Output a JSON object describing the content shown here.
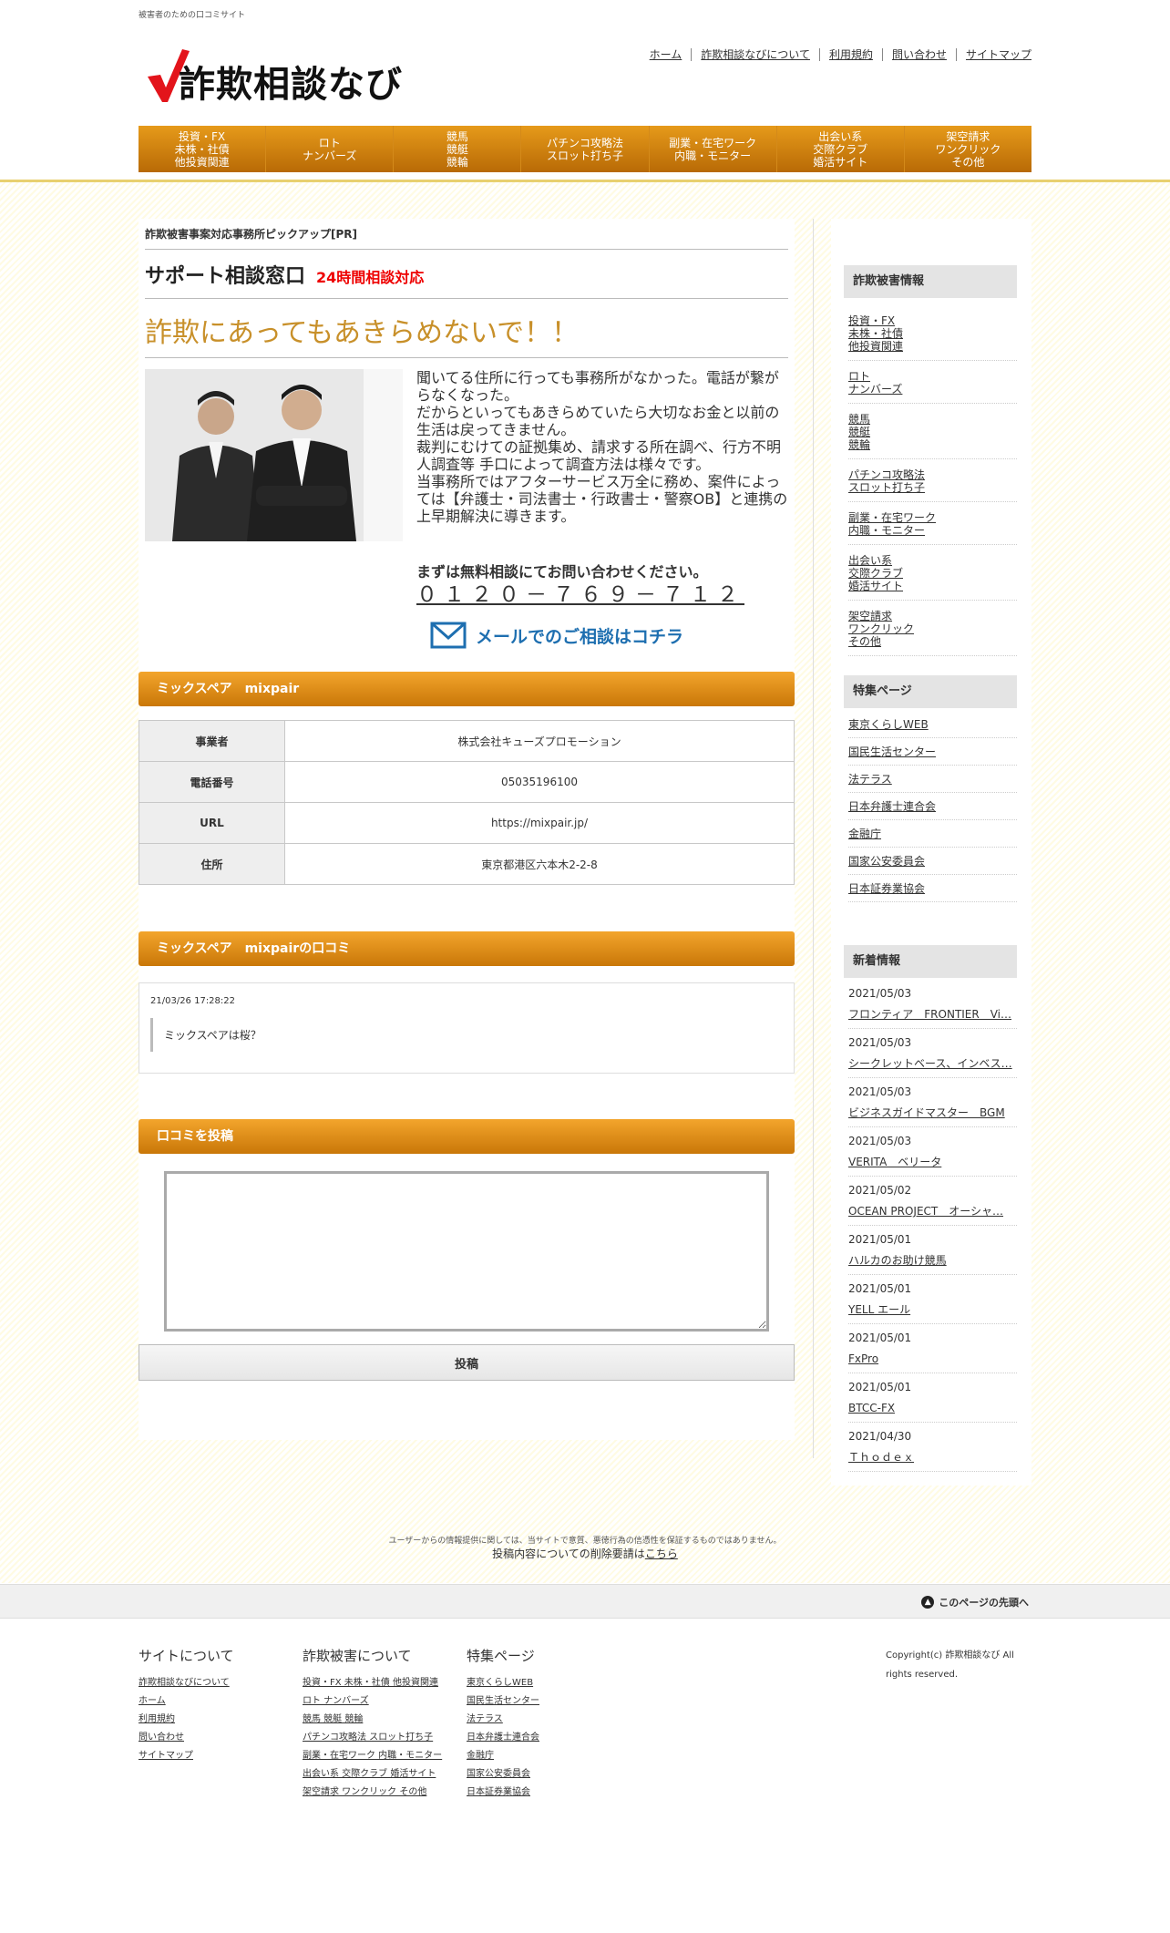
{
  "header": {
    "tagline": "被害者のための口コミサイト",
    "logo_text": "詐欺相談なび",
    "toplinks": [
      "ホーム",
      "詐欺相談なびについて",
      "利用規約",
      "問い合わせ",
      "サイトマップ"
    ]
  },
  "gnav": [
    [
      "投資・FX",
      "未株・社債",
      "他投資関連"
    ],
    [
      "ロト",
      "ナンバーズ"
    ],
    [
      "競馬",
      "競艇",
      "競輪"
    ],
    [
      "パチンコ攻略法",
      "スロット打ち子"
    ],
    [
      "副業・在宅ワーク",
      "内職・モニター"
    ],
    [
      "出会い系",
      "交際クラブ",
      "婚活サイト"
    ],
    [
      "架空請求",
      "ワンクリック",
      "その他"
    ]
  ],
  "pr": {
    "title": "詐欺被害事案対応事務所ピックアップ[PR]",
    "support": "サポート相談窓口",
    "support_note": "24時間相談対応",
    "catch": "詐欺にあってもあきらめないで！！",
    "desc": [
      "聞いてる住所に行っても事務所がなかった。電話が繋がらなくなった。",
      "だからといってもあきらめていたら大切なお金と以前の生活は戻ってきません。",
      "裁判にむけての証拠集め、請求する所在調べ、行方不明人調査等 手口によって調査方法は様々です。",
      "当事務所ではアフターサービス万全に務め、案件によっては【弁護士・司法書士・行政書士・警察OB】と連携の上早期解決に導きます。"
    ],
    "free": "まずは無料相談にてお問い合わせください。",
    "tel": "０１２０－７６９－７１２",
    "mail": "メールでのご相談はコチラ"
  },
  "company": {
    "heading": "ミックスペア　mixpair",
    "rows": [
      {
        "k": "事業者",
        "v": "株式会社キューズプロモーション"
      },
      {
        "k": "電話番号",
        "v": "05035196100"
      },
      {
        "k": "URL",
        "v": "https://mixpair.jp/"
      },
      {
        "k": "住所",
        "v": "東京都港区六本木2-2-8"
      }
    ]
  },
  "reviews": {
    "heading": "ミックスペア　mixpairの口コミ",
    "date": "21/03/26 17:28:22",
    "text": "ミックスペアは桜？"
  },
  "post": {
    "heading": "口コミを投稿",
    "button": "投稿"
  },
  "side": {
    "cat_heading": "詐欺被害情報",
    "cats": [
      [
        "投資・FX",
        "未株・社債",
        "他投資関連"
      ],
      [
        "ロト",
        "ナンバーズ"
      ],
      [
        "競馬",
        "競艇",
        "競輪"
      ],
      [
        "パチンコ攻略法",
        "スロット打ち子"
      ],
      [
        "副業・在宅ワーク",
        "内職・モニター"
      ],
      [
        "出会い系",
        "交際クラブ",
        "婚活サイト"
      ],
      [
        "架空請求",
        "ワンクリック",
        "その他"
      ]
    ],
    "special_heading": "特集ページ",
    "special": [
      "東京くらしWEB",
      "国民生活センター",
      "法テラス",
      "日本弁護士連合会",
      "金融庁",
      "国家公安委員会",
      "日本証券業協会"
    ],
    "news_heading": "新着情報",
    "news": [
      {
        "d": "2021/05/03",
        "t": "フロンティア　FRONTIER　Vi…"
      },
      {
        "d": "2021/05/03",
        "t": "シークレットベース、インベス…"
      },
      {
        "d": "2021/05/03",
        "t": "ビジネスガイドマスター　BGM"
      },
      {
        "d": "2021/05/03",
        "t": "VERITA　ベリータ"
      },
      {
        "d": "2021/05/02",
        "t": "OCEAN PROJECT　オーシャ…"
      },
      {
        "d": "2021/05/01",
        "t": "ハルカのお助け競馬"
      },
      {
        "d": "2021/05/01",
        "t": "YELL エール"
      },
      {
        "d": "2021/05/01",
        "t": "FxPro"
      },
      {
        "d": "2021/05/01",
        "t": "BTCC-FX"
      },
      {
        "d": "2021/04/30",
        "t": "Ｔｈｏｄｅｘ"
      }
    ]
  },
  "footer": {
    "notice": "ユーザーからの情報提供に関しては、当サイトで意質、悪徳行為の信憑性を保証するものではありません。",
    "notice2_pre": "投稿内容についての削除要請は",
    "notice2_link": "こちら",
    "pagetop": "このページの先頭へ",
    "cols": [
      {
        "h": "サイトについて",
        "links": [
          "詐欺相談なびについて",
          "ホーム",
          "利用規約",
          "問い合わせ",
          "サイトマップ"
        ]
      },
      {
        "h": "詐欺被害について",
        "links": [
          "投資・FX 未株・社債 他投資関連",
          "ロト ナンバーズ",
          "競馬 競艇 競輪",
          "パチンコ攻略法 スロット打ち子",
          "副業・在宅ワーク 内職・モニター",
          "出会い系 交際クラブ 婚活サイト",
          "架空請求 ワンクリック その他"
        ]
      },
      {
        "h": "特集ページ",
        "links": [
          "東京くらしWEB",
          "国民生活センター",
          "法テラス",
          "日本弁護士連合会",
          "金融庁",
          "国家公安委員会",
          "日本証券業協会"
        ]
      }
    ],
    "copyright": "Copyright(c) 詐欺相談なび All rights reserved."
  }
}
